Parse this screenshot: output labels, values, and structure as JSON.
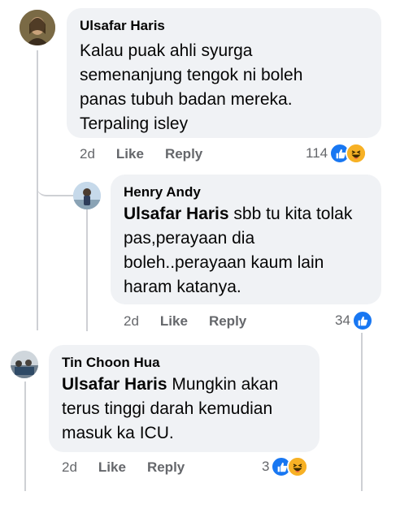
{
  "comments": [
    {
      "author": "Ulsafar Haris",
      "lines": [
        "Kalau puak ahli syurga",
        "semenanjung tengok ni boleh",
        "panas tubuh badan mereka.",
        "Terpaling isley"
      ],
      "time": "2d",
      "like_label": "Like",
      "reply_label": "Reply",
      "reaction_count": "114",
      "reactions": [
        "like-icon",
        "haha-icon"
      ]
    },
    {
      "author": "Henry Andy",
      "mention": "Ulsafar Haris",
      "lines": [
        " sbb tu kita tolak",
        "pas,perayaan dia",
        "boleh..perayaan kaum lain",
        "haram katanya."
      ],
      "time": "2d",
      "like_label": "Like",
      "reply_label": "Reply",
      "reaction_count": "34",
      "reactions": [
        "like-icon"
      ]
    },
    {
      "author": "Tin Choon Hua",
      "mention": "Ulsafar Haris",
      "lines": [
        " Mungkin akan",
        "terus tinggi darah kemudian",
        "masuk ka ICU."
      ],
      "time": "2d",
      "like_label": "Like",
      "reply_label": "Reply",
      "reaction_count": "3",
      "reactions": [
        "like-icon",
        "haha-icon"
      ]
    }
  ],
  "colors": {
    "bubble": "#f0f2f5",
    "meta_text": "#65676b",
    "like_blue": "#1877f2",
    "haha_yellow": "#f7b125",
    "thread_line": "#ced0d4"
  }
}
